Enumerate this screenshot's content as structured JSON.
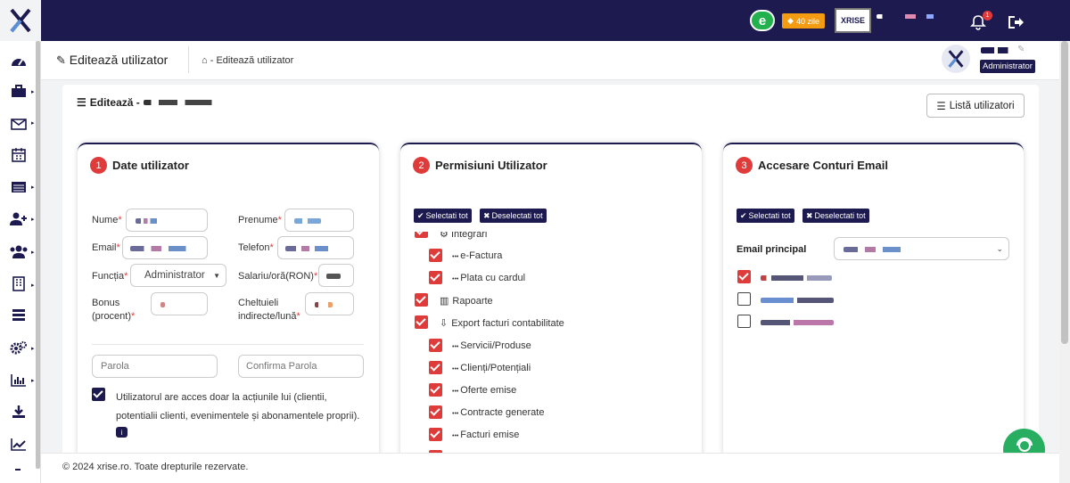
{
  "topbar": {
    "trial_badge": "40 zile",
    "brand_logo_text": "XRISE",
    "notification_count": "1"
  },
  "header": {
    "page_title": "Editează utilizator",
    "breadcrumb_current": "Editează utilizator",
    "user_role": "Administrator"
  },
  "content": {
    "heading_prefix": "Editează -",
    "list_users_button": "Listă utilizatori"
  },
  "card1": {
    "number": "1",
    "title": "Date utilizator",
    "labels": {
      "nume": "Nume",
      "prenume": "Prenume",
      "email": "Email",
      "telefon": "Telefon",
      "functia": "Funcția",
      "salariu": "Salariu/oră(RON)",
      "bonus_1": "Bonus",
      "bonus_2": "(procent)",
      "cheltuieli_1": "Cheltuieli",
      "cheltuieli_2": "indirecte/lună"
    },
    "functia_value": "Administrator",
    "parola_placeholder": "Parola",
    "confirma_placeholder": "Confirma Parola",
    "access_note": "Utilizatorul are acces doar la acțiunile lui (clientii, potentialii clienti, evenimentele și abonamentele proprii)."
  },
  "card2": {
    "number": "2",
    "title": "Permisiuni Utilizator",
    "select_all": "Selectati tot",
    "deselect_all": "Deselectati tot",
    "partial_item": "Integrari",
    "items": [
      {
        "label": "e-Factura",
        "sub": true
      },
      {
        "label": "Plata cu cardul",
        "sub": true
      },
      {
        "label": "Rapoarte",
        "sub": false
      },
      {
        "label": "Export facturi contabilitate",
        "sub": false
      },
      {
        "label": "Servicii/Produse",
        "sub": true
      },
      {
        "label": "Clienți/Potențiali",
        "sub": true
      },
      {
        "label": "Oferte emise",
        "sub": true
      },
      {
        "label": "Contracte generate",
        "sub": true
      },
      {
        "label": "Facturi emise",
        "sub": true
      }
    ]
  },
  "card3": {
    "number": "3",
    "title": "Accesare Conturi Email",
    "select_all": "Selectati tot",
    "deselect_all": "Deselectati tot",
    "email_principal_label": "Email principal",
    "accounts_checked": [
      true,
      false,
      false
    ]
  },
  "footer": {
    "copyright": "© 2024 xrise.ro. Toate drepturile rezervate."
  },
  "colors": {
    "navy": "#1c1a4e",
    "accent_red": "#e03b3b",
    "badge_orange": "#f39c12",
    "chat_green": "#27ae60"
  }
}
